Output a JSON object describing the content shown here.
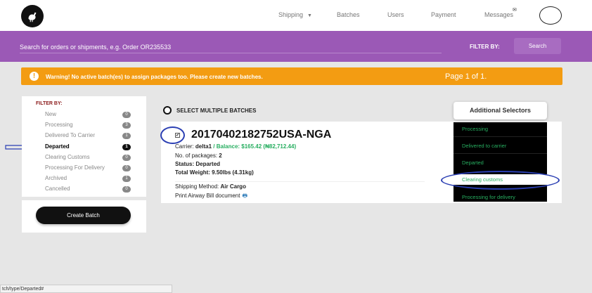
{
  "nav": {
    "items": [
      {
        "label": "Shipping",
        "has_caret": true
      },
      {
        "label": "Batches"
      },
      {
        "label": "Users"
      },
      {
        "label": "Payment"
      },
      {
        "label": "Messages"
      }
    ]
  },
  "search": {
    "placeholder": "Search for orders or shipments, e.g. Order OR235533",
    "filter_by_label": "FILTER BY:",
    "button_label": "Search"
  },
  "warning": {
    "icon": "!",
    "text": "Warning! No active batch(es) to assign packages too. Please create new batches.",
    "page_info": "Page 1 of 1."
  },
  "filter_panel": {
    "title": "FILTER BY:",
    "items": [
      {
        "label": "New",
        "count": "0"
      },
      {
        "label": "Processing",
        "count": "3"
      },
      {
        "label": "Delivered To Carrier",
        "count": "1"
      },
      {
        "label": "Departed",
        "count": "1",
        "active": true
      },
      {
        "label": "Clearing Customs",
        "count": "0"
      },
      {
        "label": "Processing For Delivery",
        "count": "0"
      },
      {
        "label": "Archived",
        "count": "1"
      },
      {
        "label": "Cancelled",
        "count": "0"
      }
    ],
    "create_button": "Create Batch"
  },
  "batches": {
    "select_multiple_label": "SELECT MULTIPLE BATCHES",
    "additional_selectors_label": "Additional Selectors",
    "card": {
      "id": "20170402182752USA-NGA",
      "carrier_label": "Carrier:",
      "carrier": "delta1",
      "balance": "/ Balance: $165.42 (₦82,712.44)",
      "packages_label": "No. of packages:",
      "packages": "2",
      "status_label": "Status:",
      "status": "Departed",
      "weight_label": "Total Weight:",
      "weight": "9.50lbs (4.31kg)",
      "shipping_label": "Shipping Method:",
      "shipping": "Air Cargo",
      "print_label": "Print Airway Bill document"
    },
    "dropdown": [
      {
        "label": "Processing"
      },
      {
        "label": "Delivered to carrier"
      },
      {
        "label": "Departed"
      },
      {
        "label": "Clearing customs",
        "highlight": true
      },
      {
        "label": "Processing for delivery"
      }
    ]
  },
  "statusbar": {
    "url": "tch/type/Departed#"
  },
  "colors": {
    "accent_purple": "#9b59b6",
    "warning_orange": "#f39c12",
    "success_green": "#27ae60",
    "annotation_blue": "#2b3fb3"
  }
}
